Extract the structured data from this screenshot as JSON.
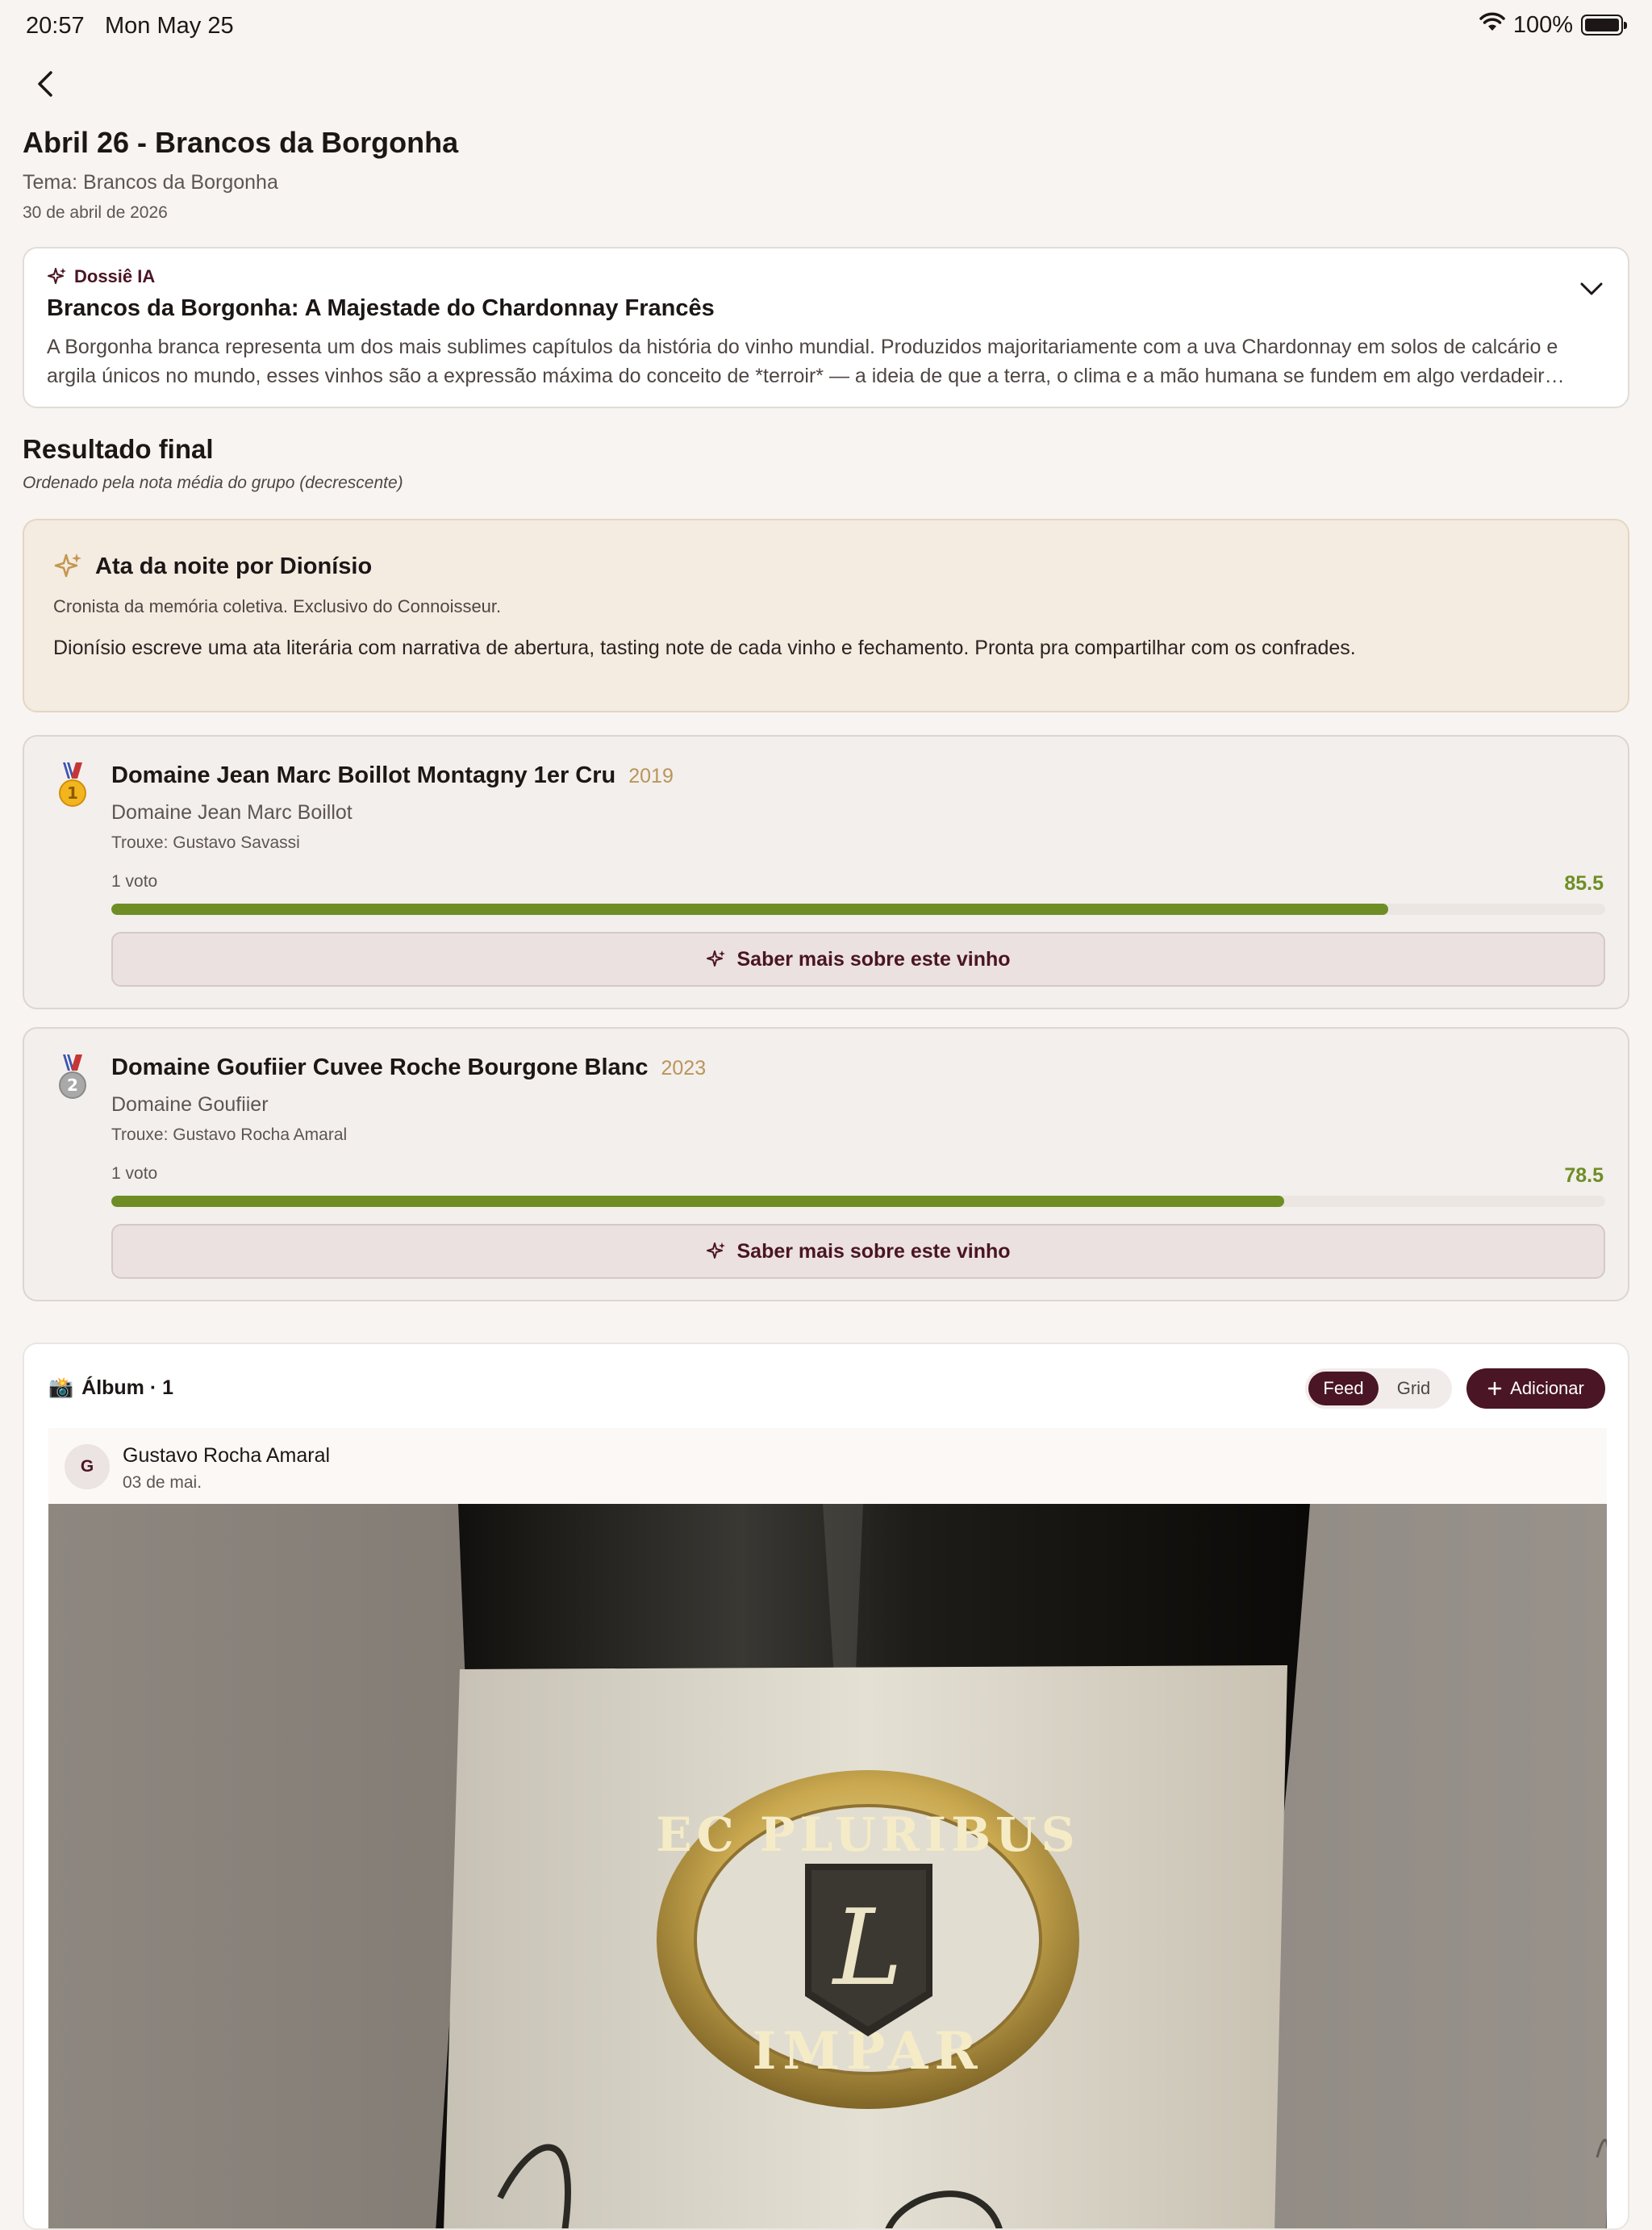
{
  "status": {
    "time": "20:57",
    "date": "Mon May 25",
    "battery": "100%"
  },
  "event": {
    "title": "Abril 26 - Brancos da Borgonha",
    "theme": "Tema: Brancos da Borgonha",
    "date": "30 de abril de 2026"
  },
  "dossier": {
    "tag": "Dossiê IA",
    "title": "Brancos da Borgonha: A Majestade do Chardonnay Francês",
    "text": "A Borgonha branca representa um dos mais sublimes capítulos da história do vinho mundial. Produzidos majoritariamente com a uva Chardonnay em solos de calcário e argila únicos no mundo, esses vinhos são a expressão máxima do conceito de *terroir* — a ideia de que a terra, o clima e a mão humana se fundem em algo verdadeir…"
  },
  "results": {
    "title": "Resultado final",
    "subtitle": "Ordenado pela nota média do grupo (decrescente)"
  },
  "ata": {
    "title": "Ata da noite por Dionísio",
    "subtitle": "Cronista da memória coletiva. Exclusivo do Connoisseur.",
    "text": "Dionísio escreve uma ata literária com narrativa de abertura, tasting note de cada vinho e fechamento. Pronta pra compartilhar com os confrades."
  },
  "wines": [
    {
      "rank": "1",
      "name": "Domaine Jean Marc Boillot Montagny 1er Cru",
      "year": "2019",
      "producer": "Domaine Jean Marc Boillot",
      "trouxe": "Trouxe: Gustavo Savassi",
      "votes": "1 voto",
      "score_label": "85.5",
      "score": 85.5,
      "button": "Saber mais sobre este vinho"
    },
    {
      "rank": "2",
      "name": "Domaine Goufiier Cuvee Roche Bourgone Blanc",
      "year": "2023",
      "producer": "Domaine Goufiier",
      "trouxe": "Trouxe: Gustavo Rocha Amaral",
      "votes": "1 voto",
      "score_label": "78.5",
      "score": 78.5,
      "button": "Saber mais sobre este vinho"
    }
  ],
  "album": {
    "icon": "📸",
    "title": "Álbum · 1",
    "view_feed": "Feed",
    "view_grid": "Grid",
    "active_view": "Feed",
    "add": "Adicionar",
    "post": {
      "avatar": "G",
      "author": "Gustavo Rocha Amaral",
      "date": "03 de mai.",
      "label_motto": "EC PLURIBUS",
      "label_brand": "IMPAR",
      "label_letter": "L"
    }
  },
  "colors": {
    "accent": "#4a1524",
    "score": "#6e8e25",
    "year": "#b9955b",
    "background": "#f7f4f1"
  }
}
